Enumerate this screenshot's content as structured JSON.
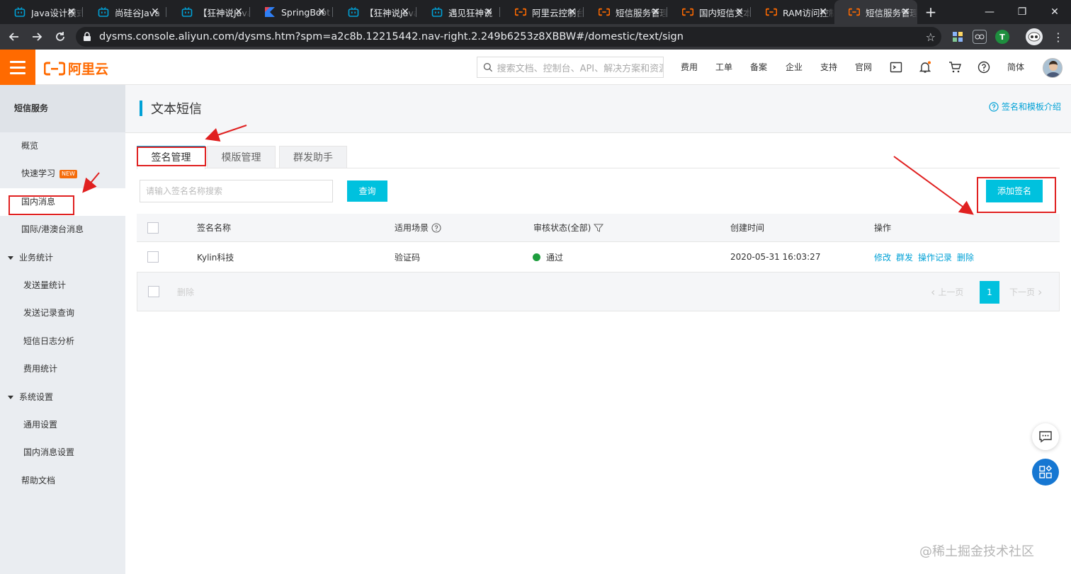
{
  "browser": {
    "tabs": [
      {
        "title": "Java设计模式",
        "icon": "bilibili-icon",
        "color": "#00a1d6"
      },
      {
        "title": "尚硅谷Java",
        "icon": "bilibili-icon",
        "color": "#00a1d6"
      },
      {
        "title": "【狂神说Java",
        "icon": "bilibili-icon",
        "color": "#00a1d6"
      },
      {
        "title": "SpringBoot",
        "icon": "kotlin-icon",
        "color": "#2f7ff5"
      },
      {
        "title": "【狂神说Java",
        "icon": "bilibili-icon",
        "color": "#00a1d6"
      },
      {
        "title": "遇见狂神说",
        "icon": "bilibili-icon",
        "color": "#00a1d6"
      },
      {
        "title": "阿里云控制台",
        "icon": "aliyun-icon",
        "color": "#ff6a00"
      },
      {
        "title": "短信服务管理",
        "icon": "aliyun-icon",
        "color": "#ff6a00"
      },
      {
        "title": "国内短信文本",
        "icon": "aliyun-icon",
        "color": "#ff6a00"
      },
      {
        "title": "RAM访问控制",
        "icon": "aliyun-icon",
        "color": "#ff6a00"
      },
      {
        "title": "短信服务管理",
        "icon": "aliyun-icon",
        "color": "#ff6a00",
        "active": true
      }
    ],
    "url": "dysms.console.aliyun.com/dysms.htm?spm=a2c8b.12215442.nav-right.2.249b6253z8XBBW#/domestic/text/sign"
  },
  "header": {
    "logo_text": "阿里云",
    "search_placeholder": "搜索文档、控制台、API、解决方案和资源",
    "nav": [
      "费用",
      "工单",
      "备案",
      "企业",
      "支持",
      "官网"
    ],
    "lang": "简体",
    "brand_color": "#ff6a00"
  },
  "sidebar": {
    "title": "短信服务",
    "items": [
      {
        "label": "概览"
      },
      {
        "label": "快速学习",
        "badge": "NEW"
      },
      {
        "label": "国内消息"
      },
      {
        "label": "国际/港澳台消息"
      },
      {
        "label": "业务统计"
      },
      {
        "label": "发送量统计"
      },
      {
        "label": "发送记录查询"
      },
      {
        "label": "短信日志分析"
      },
      {
        "label": "费用统计"
      },
      {
        "label": "系统设置"
      },
      {
        "label": "通用设置"
      },
      {
        "label": "国内消息设置"
      },
      {
        "label": "帮助文档"
      }
    ]
  },
  "page": {
    "title": "文本短信",
    "help_link": "签名和模板介绍",
    "tabs": [
      "签名管理",
      "模版管理",
      "群发助手"
    ],
    "search_placeholder": "请输入签名名称搜索",
    "query_button": "查询",
    "add_button": "添加签名",
    "accent_color": "#00c1de",
    "table": {
      "columns": [
        "签名名称",
        "适用场景",
        "审核状态(全部)",
        "创建时间",
        "操作"
      ],
      "rows": [
        {
          "name": "Kylin科技",
          "scene": "验证码",
          "status": "通过",
          "created": "2020-05-31 16:03:27",
          "actions": [
            "修改",
            "群发",
            "操作记录",
            "删除"
          ]
        }
      ],
      "footer_delete": "删除",
      "pagination": {
        "prev": "上一页",
        "page": "1",
        "next": "下一页"
      }
    }
  },
  "watermark": "@稀土掘金技术社区"
}
